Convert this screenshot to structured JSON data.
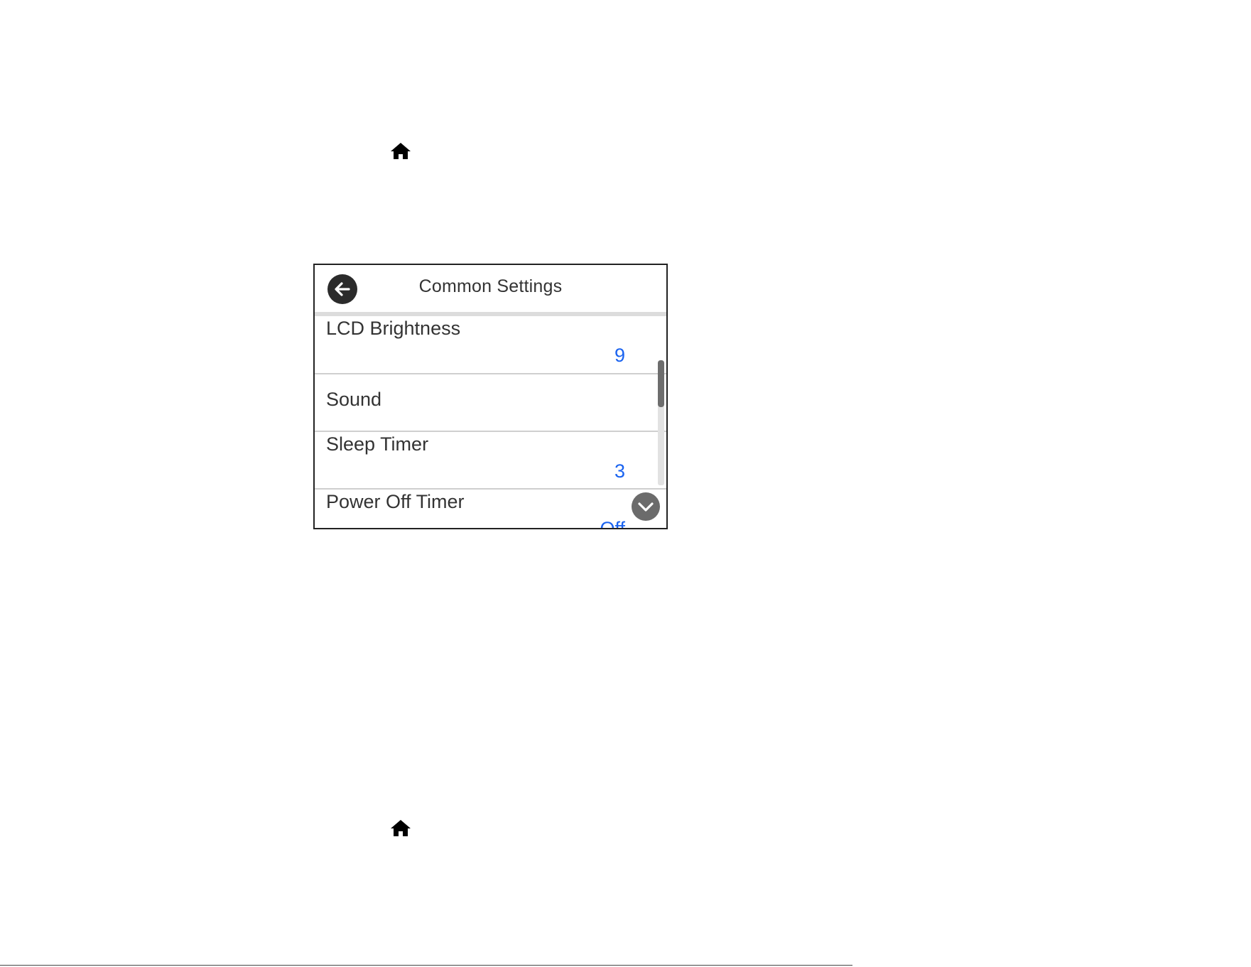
{
  "icons": {
    "home_top": "home-icon",
    "home_bottom": "home-icon",
    "back": "arrow-left-icon",
    "scroll_down": "chevron-down-icon"
  },
  "panel": {
    "title": "Common Settings",
    "items": [
      {
        "label": "LCD Brightness",
        "value": "9"
      },
      {
        "label": "Sound",
        "value": ""
      },
      {
        "label": "Sleep Timer",
        "value": "3"
      },
      {
        "label": "Power Off Timer",
        "value": "Off"
      }
    ]
  },
  "colors": {
    "value_text": "#1a63f0",
    "label_text": "#333333",
    "button_dark": "#2b2b2b"
  }
}
